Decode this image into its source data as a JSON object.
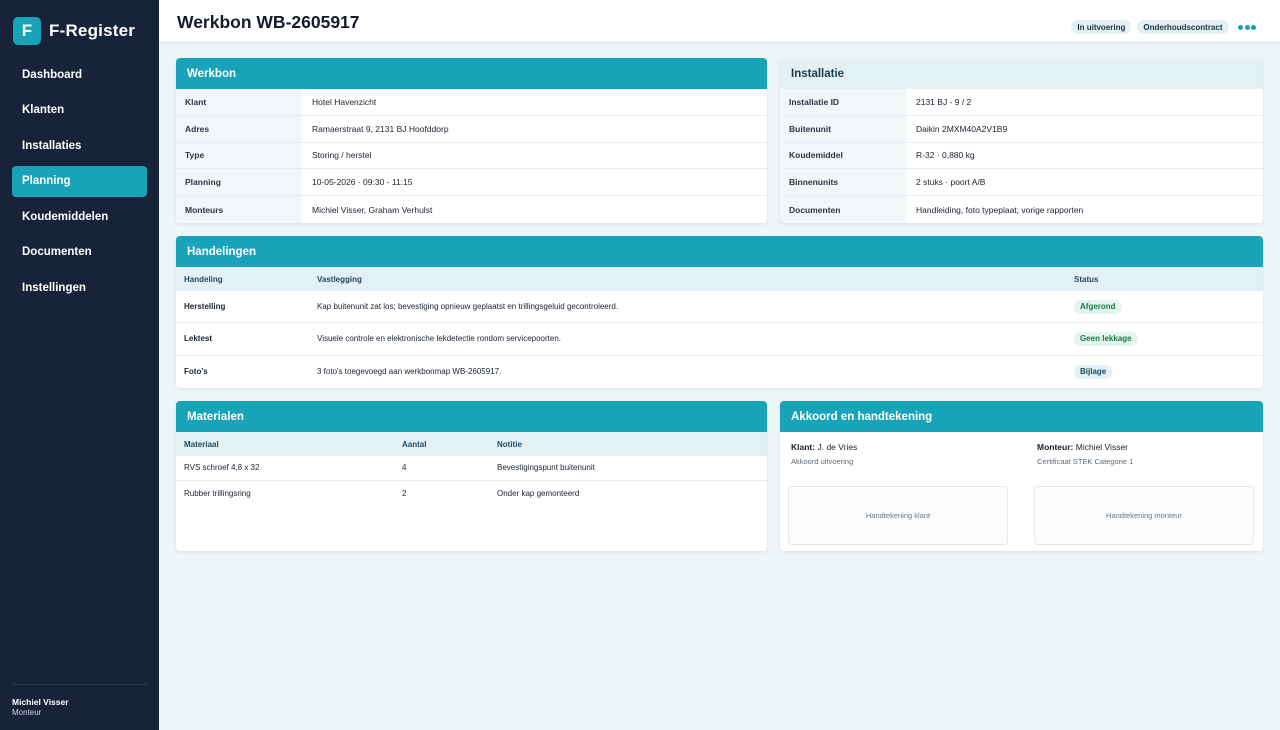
{
  "app": {
    "logo_letter": "F",
    "name": "F-Register"
  },
  "sidebar": {
    "items": [
      {
        "label": "Dashboard"
      },
      {
        "label": "Klanten"
      },
      {
        "label": "Installaties"
      },
      {
        "label": "Planning"
      },
      {
        "label": "Koudemiddelen"
      },
      {
        "label": "Documenten"
      },
      {
        "label": "Instellingen"
      }
    ],
    "active_item": "Planning",
    "user": {
      "name": "Michiel Visser",
      "role": "Monteur"
    }
  },
  "header": {
    "title": "Werkbon WB-2605917",
    "badges": [
      "In uitvoering",
      "Onderhoudscontract"
    ],
    "more_icon": "more-dots-icon"
  },
  "werkbon": {
    "title": "Werkbon",
    "rows": [
      {
        "label": "Klant",
        "value": "Hotel Havenzicht"
      },
      {
        "label": "Adres",
        "value": "Ramaerstraat 9, 2131 BJ Hoofddorp"
      },
      {
        "label": "Type",
        "value": "Storing / herstel"
      },
      {
        "label": "Planning",
        "value": "10-05-2026 · 09:30 - 11:15"
      },
      {
        "label": "Monteurs",
        "value": "Michiel Visser, Graham Verhulst"
      }
    ]
  },
  "installatie": {
    "title": "Installatie",
    "rows": [
      {
        "label": "Installatie ID",
        "value": "2131 BJ - 9 / 2"
      },
      {
        "label": "Buitenunit",
        "value": "Daikin 2MXM40A2V1B9"
      },
      {
        "label": "Koudemiddel",
        "value": "R-32 · 0,880 kg"
      },
      {
        "label": "Binnenunits",
        "value": "2 stuks · poort A/B"
      },
      {
        "label": "Documenten",
        "value": "Handleiding, foto typeplaat, vorige rapporten"
      }
    ]
  },
  "handelingen": {
    "title": "Handelingen",
    "columns": [
      "Handeling",
      "Vastlegging",
      "Status"
    ],
    "rows": [
      {
        "handeling": "Herstelling",
        "vastlegging": "Kap buitenunit zat los; bevestiging opnieuw geplaatst en trillingsgeluid gecontroleerd.",
        "status": "Afgerond"
      },
      {
        "handeling": "Lektest",
        "vastlegging": "Visuele controle en elektronische lekdetectie rondom servicepoorten.",
        "status": "Geen lekkage"
      },
      {
        "handeling": "Foto's",
        "vastlegging": "3 foto's toegevoegd aan werkbonmap WB-2605917.",
        "status": "Bijlage"
      }
    ],
    "colors": {
      "status_ok": "#157a46",
      "status_ok_bg": "#e6f4ef",
      "status_info_bg": "#e3f1f4"
    }
  },
  "materialen": {
    "title": "Materialen",
    "columns": [
      "Materiaal",
      "Aantal",
      "Notitie"
    ],
    "rows": [
      {
        "materiaal": "RVS schroef 4,8 x 32",
        "aantal": "4",
        "notitie": "Bevestigingspunt buitenunit"
      },
      {
        "materiaal": "Rubber trillingsring",
        "aantal": "2",
        "notitie": "Onder kap gemonteerd"
      }
    ]
  },
  "akkoord": {
    "title": "Akkoord en handtekening",
    "klant": {
      "label": "Klant:",
      "name": "J. de Vries",
      "sub": "Akkoord uitvoering",
      "box": "Handtekening klant"
    },
    "monteur": {
      "label": "Monteur:",
      "name": "Michiel Visser",
      "sub": "Certificaat STEK Categorie 1",
      "box": "Handtekening monteur"
    }
  },
  "colors": {
    "accent": "#19a3b8",
    "sidebar": "#182238",
    "background": "#edf5f7"
  }
}
